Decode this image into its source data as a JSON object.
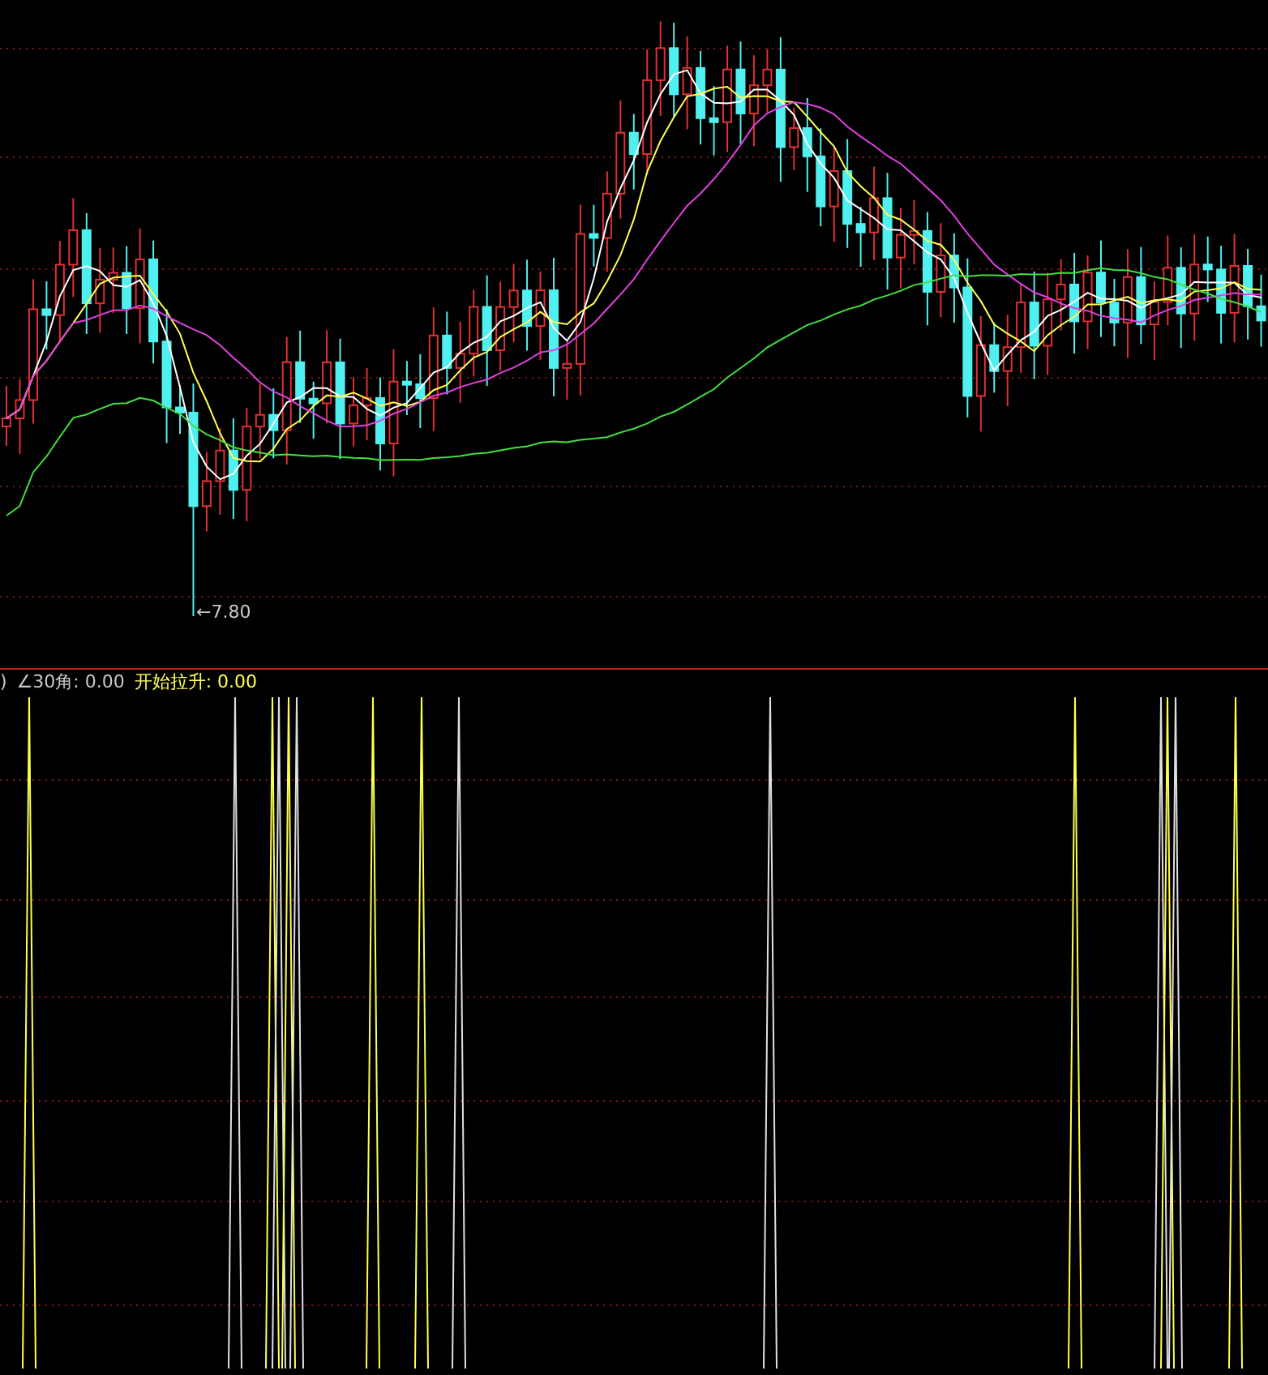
{
  "price_chart": {
    "low_marker": "←7.80"
  },
  "indicator": {
    "legend": [
      {
        "text": ")",
        "color": "#c8c8c8"
      },
      {
        "text": "∠30角: 0.00",
        "color": "#c8c8c8"
      },
      {
        "text": "开始拉升: 0.00",
        "color": "#ffff50"
      }
    ]
  }
}
